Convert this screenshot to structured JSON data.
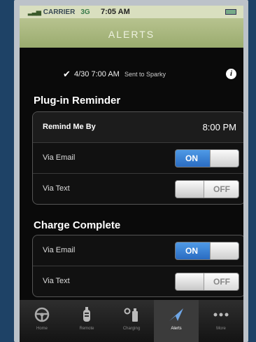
{
  "status_bar": {
    "carrier": "CARRIER",
    "network": "3G",
    "time": "7:05 AM"
  },
  "header": {
    "title": "ALERTS"
  },
  "last_sent": {
    "timestamp": "4/30 7:00 AM",
    "note": "Sent to Sparky"
  },
  "plugin_reminder": {
    "title": "Plug-in Reminder",
    "remind_label": "Remind Me By",
    "remind_value": "8:00 PM",
    "email_label": "Via Email",
    "email_state": "ON",
    "text_label": "Via Text",
    "text_state": "OFF"
  },
  "charge_complete": {
    "title": "Charge Complete",
    "email_label": "Via Email",
    "email_state": "ON",
    "text_label": "Via Text",
    "text_state": "OFF"
  },
  "tabs": [
    {
      "label": "Home",
      "icon": "steering-wheel-icon"
    },
    {
      "label": "Remote",
      "icon": "key-fob-icon"
    },
    {
      "label": "Charging",
      "icon": "charging-plug-icon"
    },
    {
      "label": "Alerts",
      "icon": "alert-arrow-icon"
    },
    {
      "label": "More",
      "icon": "more-dots-icon"
    }
  ],
  "colors": {
    "accent": "#2a6cc2",
    "header": "#a4b37a",
    "background": "#0a0a0a"
  }
}
